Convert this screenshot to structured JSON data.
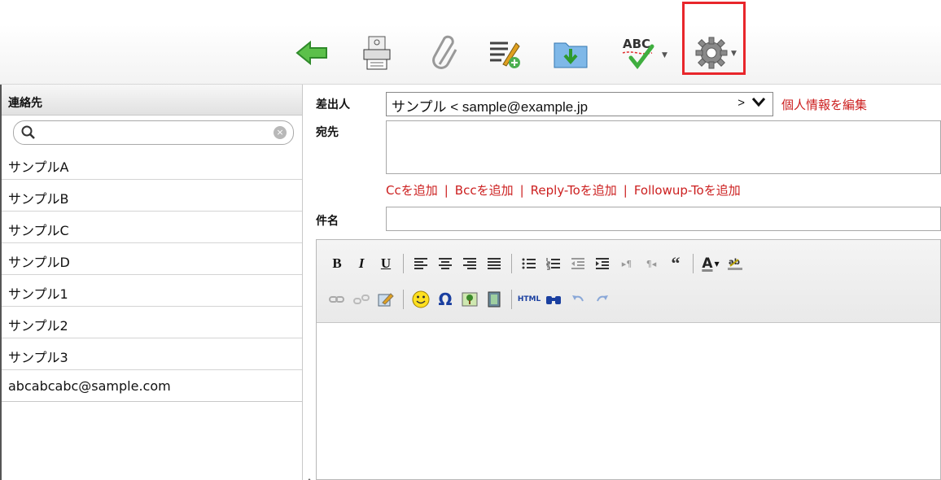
{
  "toolbar": {
    "buttons": [
      {
        "name": "back-arrow-icon",
        "color": "#3aa03a"
      },
      {
        "name": "scanner-icon"
      },
      {
        "name": "paperclip-icon"
      },
      {
        "name": "signature-icon"
      },
      {
        "name": "save-folder-icon"
      },
      {
        "name": "spellcheck-icon",
        "label": "ABC"
      },
      {
        "name": "gear-icon"
      }
    ],
    "highlight_color": "#e8262b"
  },
  "sidebar": {
    "title": "連絡先",
    "search_placeholder": "",
    "contacts": [
      "サンプルA",
      "サンプルB",
      "サンプルC",
      "サンプルD",
      "サンプル1",
      "サンプル2",
      "サンプル3",
      "abcabcabc@sample.com"
    ]
  },
  "compose": {
    "from_label": "差出人",
    "from_value": "サンプル < sample@example.jp",
    "from_suffix": ">",
    "edit_profile_link": "個人情報を編集",
    "to_label": "宛先",
    "add_links": [
      "Ccを追加",
      "Bccを追加",
      "Reply-Toを追加",
      "Followup-Toを追加"
    ],
    "subject_label": "件名"
  },
  "editor": {
    "row1": [
      "B",
      "I",
      "U",
      "|",
      "align-left-icon",
      "align-center-icon",
      "align-right-icon",
      "justify-icon",
      "|",
      "bullet-list-icon",
      "numbered-list-icon",
      "outdent-icon",
      "indent-icon",
      "ltr-icon",
      "rtl-icon",
      "blockquote-icon",
      "|",
      "font-color-icon",
      "highlight-color-icon"
    ],
    "row2": [
      "link-icon",
      "unlink-icon",
      "edit-icon",
      "|",
      "emoticon-icon",
      "special-char-icon",
      "image-icon",
      "media-icon",
      "|",
      "html-source-icon",
      "search-replace-icon",
      "undo-icon",
      "redo-icon"
    ],
    "html_label": "HTML",
    "omega": "Ω",
    "quote": "“"
  },
  "colors": {
    "link_red": "#cc1f1f",
    "accent_green": "#3aa03a"
  }
}
